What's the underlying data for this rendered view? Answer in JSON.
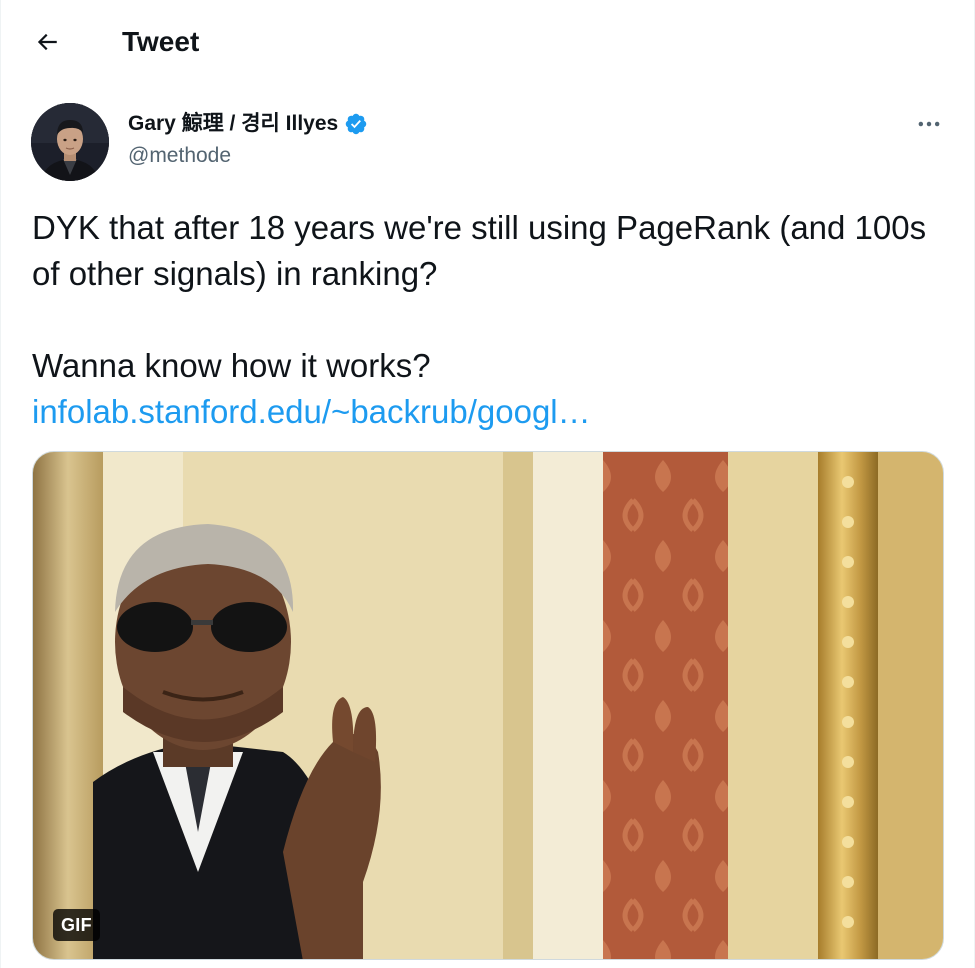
{
  "header": {
    "back_icon": "arrow-left-icon",
    "title": "Tweet"
  },
  "author": {
    "display_name": "Gary 鯨理 / 경리 Illyes",
    "handle": "@methode",
    "verified_icon": "verified-badge-icon",
    "badge_color": "#1d9bf0"
  },
  "more_icon": "more-horizontal-icon",
  "tweet": {
    "line1": "DYK that after 18 years we're still using PageRank (and 100s of other signals) in ranking?",
    "line2": "Wanna know how it works?",
    "link_text": "infolab.stanford.edu/~backrub/googl…",
    "link_color": "#1d9bf0"
  },
  "media": {
    "badge": "GIF"
  }
}
